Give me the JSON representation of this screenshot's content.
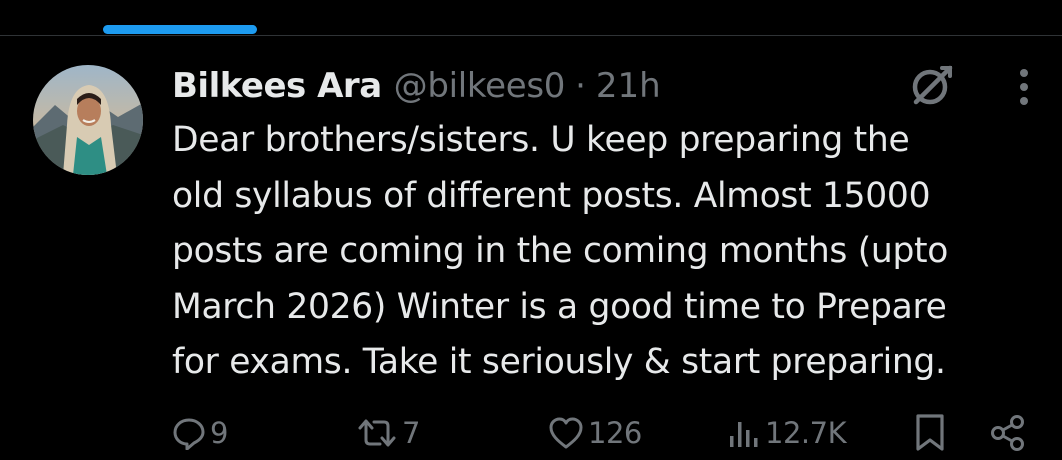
{
  "author": {
    "display_name": "Bilkees Ara",
    "handle": "@bilkees0",
    "separator": "·",
    "time": "21h"
  },
  "tweet": {
    "lines": [
      "Dear brothers/sisters. U keep preparing the",
      "old syllabus of different posts. Almost 15000",
      "posts are coming in the coming months (upto",
      "March 2026) Winter is a good time to Prepare",
      "for exams. Take it seriously & start preparing."
    ]
  },
  "actions": {
    "replies": "9",
    "reposts": "7",
    "likes": "126",
    "views": "12.7K"
  },
  "icons": {
    "top_right": [
      "grok-icon",
      "more-icon"
    ],
    "actions": [
      "reply-icon",
      "repost-icon",
      "like-icon",
      "views-icon",
      "bookmark-icon",
      "share-icon"
    ]
  },
  "colors": {
    "background": "#000000",
    "text_primary": "#e7e9ea",
    "text_secondary": "#71767b",
    "accent": "#1d9bf0",
    "divider": "#2f3336"
  }
}
